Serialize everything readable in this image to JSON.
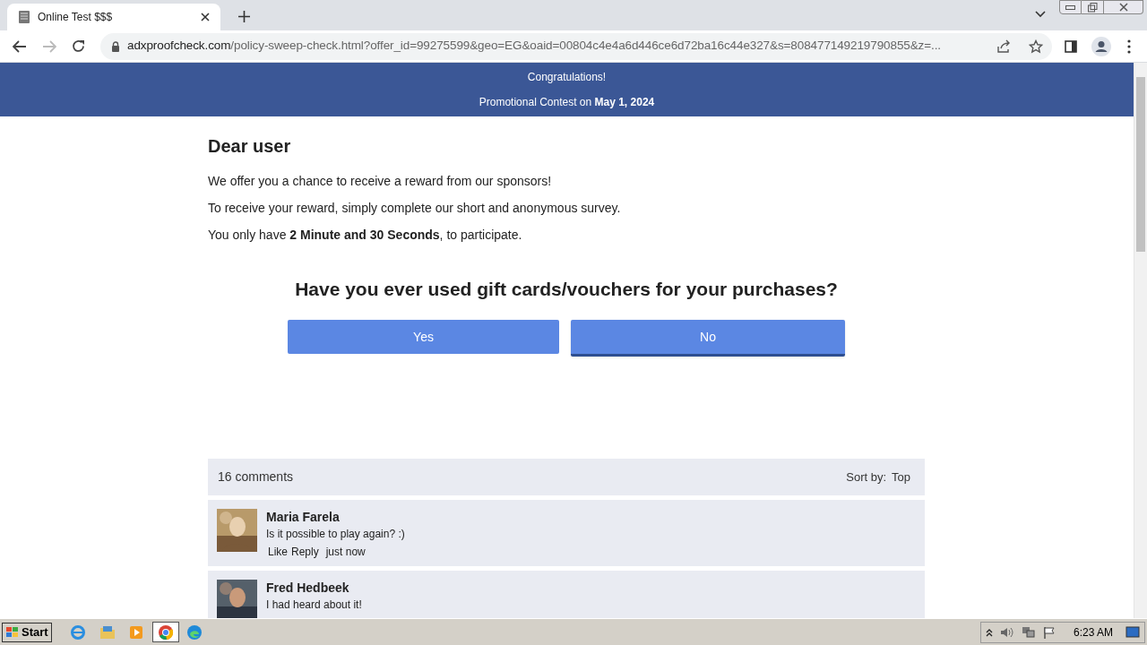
{
  "browser": {
    "tab_title": "Online Test $$$",
    "url_domain": "adxproofcheck.com",
    "url_path": "/policy-sweep-check.html?offer_id=99275599&geo=EG&oaid=00804c4e4a6d446ce6d72ba16c44e327&s=808477149219790855&z=..."
  },
  "banner": {
    "title": "Congratulations!",
    "subtitle": "Promotional Contest on **May 1, 2024**"
  },
  "letter": {
    "heading": "Dear user",
    "paragraphs": [
      "We offer you a chance to receive a reward from our sponsors!",
      "To receive your reward, simply complete our short and anonymous survey.",
      "You only have **2 Minute and 30 Seconds**, to participate."
    ]
  },
  "question": {
    "text": "Have you ever used gift cards/vouchers for your purchases?",
    "answers": [
      {
        "label": "Yes",
        "selected": false
      },
      {
        "label": "No",
        "selected": true
      }
    ]
  },
  "comments": {
    "count": "16 comments",
    "sort_label": "Sort by:",
    "sort_value": "Top",
    "items": [
      {
        "name": "Maria Farela",
        "text": "Is it possible to play again? :)",
        "like": "Like",
        "reply": "Reply",
        "time": "just now"
      },
      {
        "name": "Fred Hedbeek",
        "text": "I had heard about it!"
      }
    ]
  },
  "taskbar": {
    "start": "Start",
    "clock": "6:23 AM"
  }
}
